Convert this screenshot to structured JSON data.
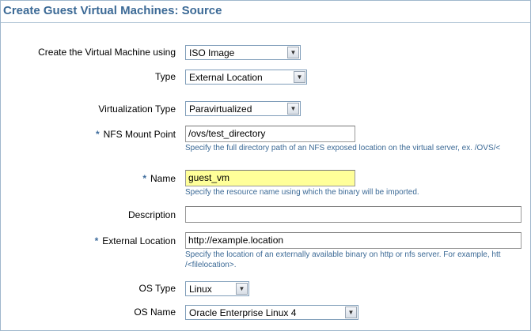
{
  "page": {
    "title": "Create Guest Virtual Machines: Source"
  },
  "form": {
    "create_using": {
      "label": "Create the Virtual Machine using",
      "value": "ISO Image"
    },
    "type": {
      "label": "Type",
      "value": "External Location"
    },
    "virt_type": {
      "label": "Virtualization Type",
      "value": "Paravirtualized"
    },
    "nfs_mount": {
      "label": "NFS Mount Point",
      "value": "/ovs/test_directory",
      "hint": "Specify the full directory path of an NFS exposed location on the virtual server, ex. /OVS/<"
    },
    "name": {
      "label": "Name",
      "value": "guest_vm",
      "hint": "Specify the resource name using which the binary will be imported."
    },
    "description": {
      "label": "Description",
      "value": ""
    },
    "external_location": {
      "label": "External Location",
      "value": "http://example.location",
      "hint1": "Specify the location of an externally available binary on http or nfs server. For example, htt",
      "hint2": "/<filelocation>."
    },
    "os_type": {
      "label": "OS Type",
      "value": "Linux"
    },
    "os_name": {
      "label": "OS Name",
      "value": "Oracle Enterprise Linux 4"
    },
    "required_marker": "*"
  },
  "colors": {
    "title": "#3c6a96",
    "hint": "#3c6a96",
    "highlight": "#ffff99"
  }
}
